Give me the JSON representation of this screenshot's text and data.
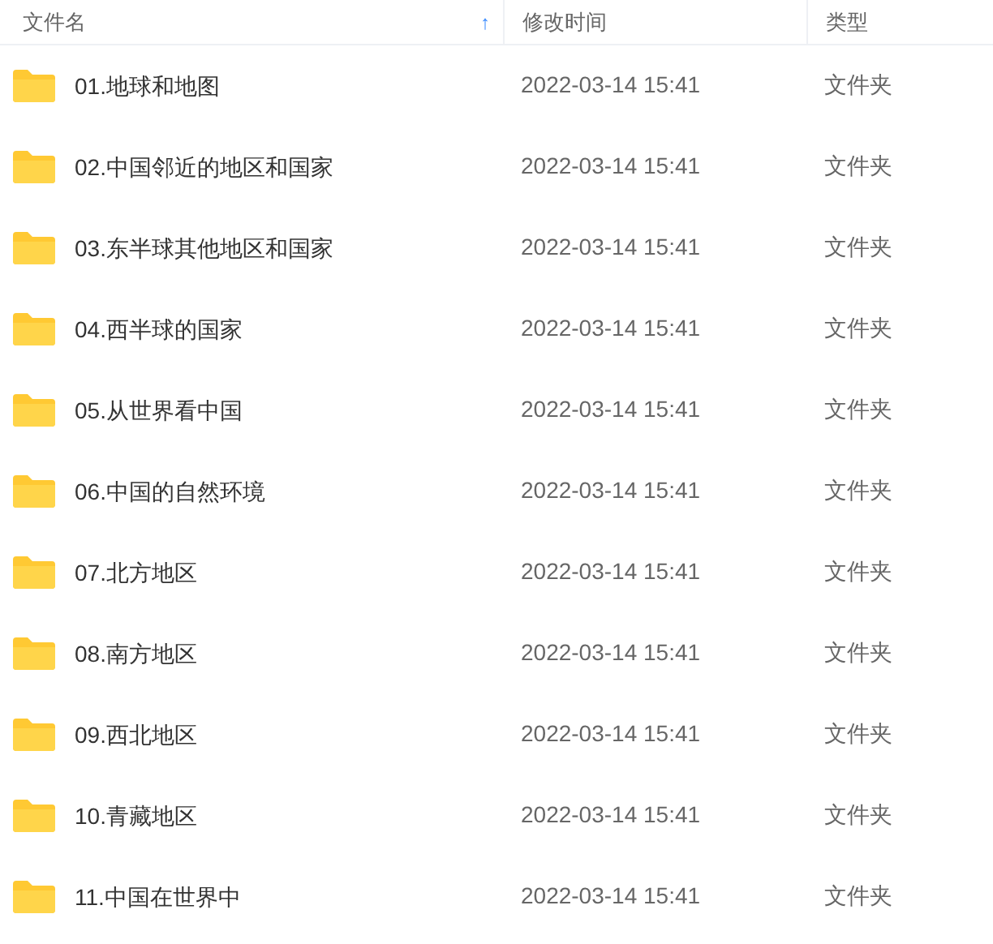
{
  "columns": [
    {
      "label": "文件名",
      "sorted": true
    },
    {
      "label": "修改时间",
      "sorted": false
    },
    {
      "label": "类型",
      "sorted": false
    }
  ],
  "sort_arrow": "↑",
  "rows": [
    {
      "name": "01.地球和地图",
      "modified": "2022-03-14 15:41",
      "type": "文件夹"
    },
    {
      "name": "02.中国邻近的地区和国家",
      "modified": "2022-03-14 15:41",
      "type": "文件夹"
    },
    {
      "name": "03.东半球其他地区和国家",
      "modified": "2022-03-14 15:41",
      "type": "文件夹"
    },
    {
      "name": "04.西半球的国家",
      "modified": "2022-03-14 15:41",
      "type": "文件夹"
    },
    {
      "name": "05.从世界看中国",
      "modified": "2022-03-14 15:41",
      "type": "文件夹"
    },
    {
      "name": "06.中国的自然环境",
      "modified": "2022-03-14 15:41",
      "type": "文件夹"
    },
    {
      "name": "07.北方地区",
      "modified": "2022-03-14 15:41",
      "type": "文件夹"
    },
    {
      "name": "08.南方地区",
      "modified": "2022-03-14 15:41",
      "type": "文件夹"
    },
    {
      "name": "09.西北地区",
      "modified": "2022-03-14 15:41",
      "type": "文件夹"
    },
    {
      "name": "10.青藏地区",
      "modified": "2022-03-14 15:41",
      "type": "文件夹"
    },
    {
      "name": "11.中国在世界中",
      "modified": "2022-03-14 15:41",
      "type": "文件夹"
    }
  ]
}
